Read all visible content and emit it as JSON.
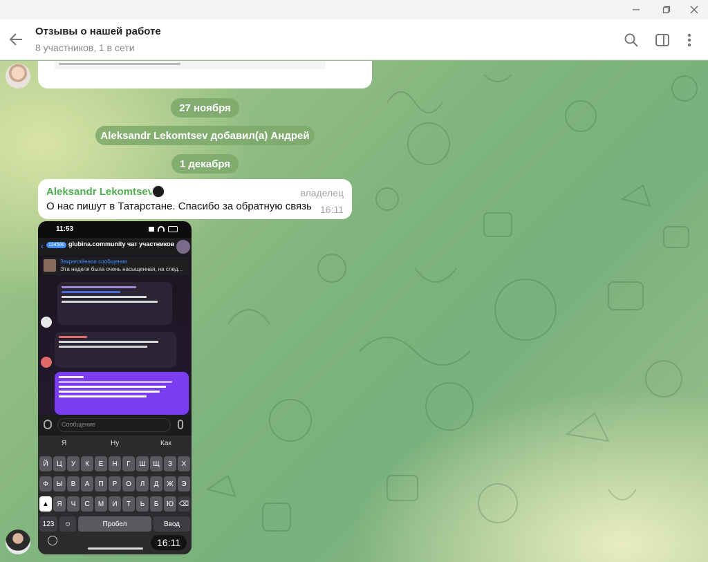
{
  "window": {
    "controls": [
      "minimize-icon",
      "restore-icon",
      "close-icon"
    ]
  },
  "header": {
    "title": "Отзывы о нашей работе",
    "subtitle": "8 участников, 1 в сети",
    "icons": [
      "back-arrow-icon",
      "search-icon",
      "sidebar-panel-icon",
      "more-vertical-icon"
    ]
  },
  "chat": {
    "date_separators": [
      "27 ноября",
      "1 декабря"
    ],
    "service_message": "Aleksandr Lekomtsev добавил(а) Андрей",
    "message": {
      "author": "Aleksandr Lekomtsev",
      "role": "владелец",
      "text": "О нас пишут в Татарстане. Спасибо за обратную связь",
      "time": "16:11"
    },
    "photo": {
      "time": "16:11",
      "status_time": "11:53",
      "chat_name": "glubina.community чат участников",
      "back_count": "134590",
      "pinned_label": "Закреплённое сообщение",
      "pinned_text": "Эта неделя была очень насыщенная, на след...",
      "input_placeholder": "Сообщение",
      "suggestions": [
        "Я",
        "Ну",
        "Как"
      ],
      "keyboard_rows": [
        [
          "Й",
          "Ц",
          "У",
          "К",
          "Е",
          "Н",
          "Г",
          "Ш",
          "Щ",
          "З",
          "Х"
        ],
        [
          "Ф",
          "Ы",
          "В",
          "А",
          "П",
          "Р",
          "О",
          "Л",
          "Д",
          "Ж",
          "Э"
        ],
        [
          "Я",
          "Ч",
          "С",
          "М",
          "И",
          "Т",
          "Ь",
          "Б",
          "Ю"
        ]
      ],
      "key_123": "123",
      "key_space": "Пробел",
      "key_enter": "Ввод"
    }
  },
  "colors": {
    "author_green": "#4fae4e",
    "service_pill": "#7da86b"
  }
}
